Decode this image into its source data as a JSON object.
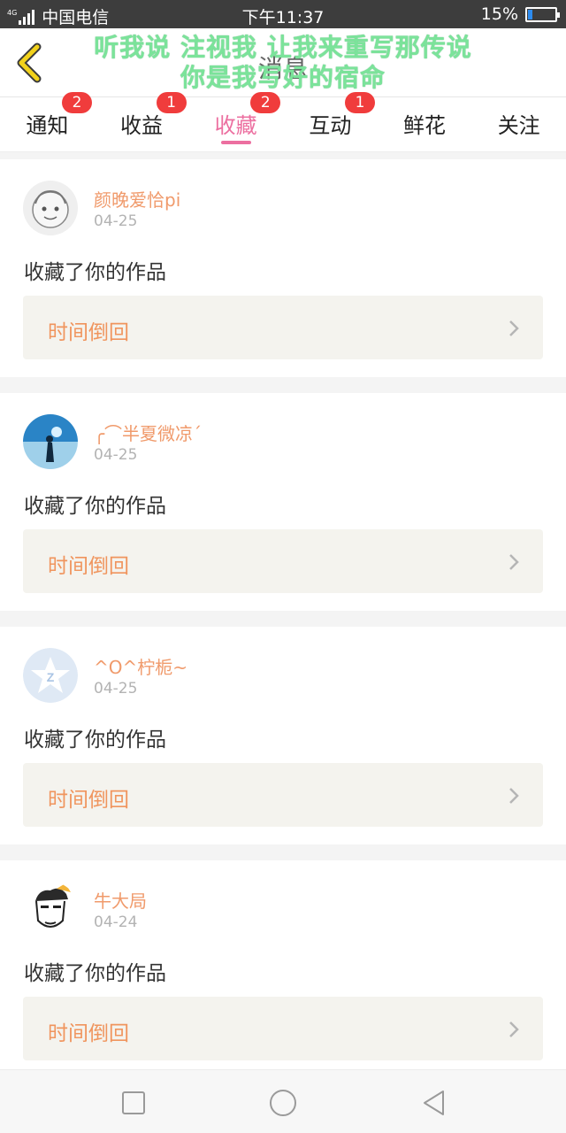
{
  "status_bar": {
    "network": "4G",
    "carrier": "中国电信",
    "time": "下午11:37",
    "battery": "15%",
    "battery_level": 0.15
  },
  "header": {
    "title": "消息",
    "overlay_line1": "听我说 注视我 让我来重写那传说",
    "overlay_line2": "你是我写好的宿命"
  },
  "tabs": [
    {
      "label": "通知",
      "badge": "2"
    },
    {
      "label": "收益",
      "badge": "1"
    },
    {
      "label": "收藏",
      "badge": "2",
      "active": true
    },
    {
      "label": "互动",
      "badge": "1"
    },
    {
      "label": "鲜花",
      "badge": ""
    },
    {
      "label": "关注",
      "badge": ""
    }
  ],
  "feed": [
    {
      "username": "颜晚爱恰pi",
      "date": "04-25",
      "action": "收藏了你的作品",
      "work": "时间倒回",
      "avatar": "cartoon-lion-avatar"
    },
    {
      "username": "╭⌒半夏微凉ˊ",
      "date": "04-25",
      "action": "收藏了你的作品",
      "work": "时间倒回",
      "avatar": "couple-sunset-avatar"
    },
    {
      "username": "^O^柠栀~",
      "date": "04-25",
      "action": "收藏了你的作品",
      "work": "时间倒回",
      "avatar": "qzone-star-avatar"
    },
    {
      "username": "牛大局",
      "date": "04-24",
      "action": "收藏了你的作品",
      "work": "时间倒回",
      "avatar": "cartoon-face-avatar"
    }
  ],
  "colors": {
    "accent_pink": "#ec6fa0",
    "badge_red": "#f03c3c",
    "username_orange": "#f09a6b",
    "overlay_green": "#7be39a"
  }
}
